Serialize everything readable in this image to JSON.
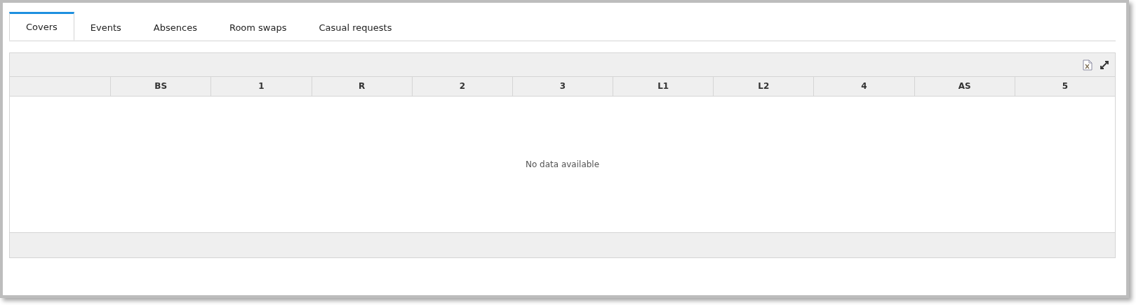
{
  "tabs": [
    {
      "label": "Covers",
      "selected": true
    },
    {
      "label": "Events",
      "selected": false
    },
    {
      "label": "Absences",
      "selected": false
    },
    {
      "label": "Room swaps",
      "selected": false
    },
    {
      "label": "Casual requests",
      "selected": false
    }
  ],
  "table": {
    "columns": [
      "",
      "BS",
      "1",
      "R",
      "2",
      "3",
      "L1",
      "L2",
      "4",
      "AS",
      "5"
    ],
    "empty_message": "No data available"
  }
}
